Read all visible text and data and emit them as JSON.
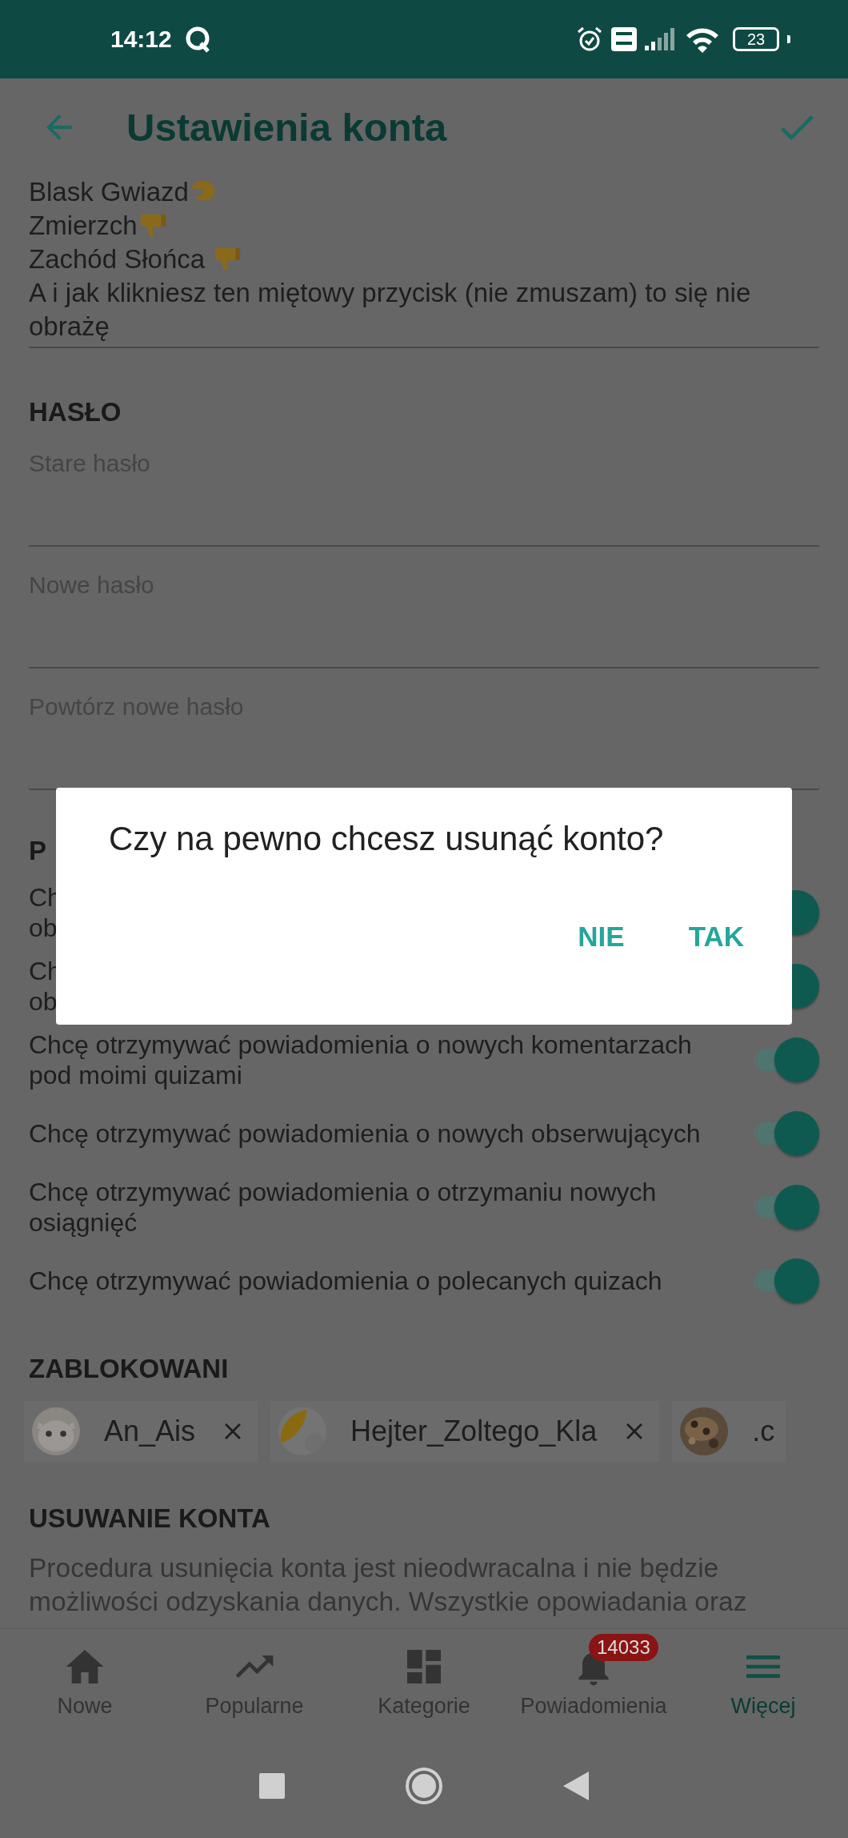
{
  "status_bar": {
    "time": "14:12",
    "battery": "23"
  },
  "app_bar": {
    "title": "Ustawienia konta"
  },
  "bio": {
    "lines": [
      {
        "text": "Blask Gwiazd",
        "kind": "ok-hand"
      },
      {
        "text": "Zmierzch",
        "kind": "thumbs-down"
      },
      {
        "text": "Zachód Słońca ",
        "kind": "thumbs-down"
      },
      {
        "text": "A i jak klikniesz ten miętowy przycisk (nie zmuszam) to się nie obrażę",
        "kind": "plain"
      }
    ]
  },
  "password": {
    "heading": "HASŁO",
    "fields": [
      {
        "placeholder": "Stare hasło"
      },
      {
        "placeholder": "Nowe hasło"
      },
      {
        "placeholder": "Powtórz nowe hasło"
      }
    ]
  },
  "notifications": {
    "heading": "P",
    "rows": [
      {
        "text": "Ch\nob",
        "checked": true
      },
      {
        "text": "Ch\nob",
        "checked": true
      },
      {
        "text": "Chcę otrzymywać powiadomienia o nowych komentarzach pod moimi quizami",
        "checked": true
      },
      {
        "text": "Chcę otrzymywać powiadomienia o nowych obserwujących",
        "checked": true
      },
      {
        "text": "Chcę otrzymywać powiadomienia o otrzymaniu nowych osiągnięć",
        "checked": true
      },
      {
        "text": "Chcę otrzymywać powiadomienia o polecanych quizach",
        "checked": true
      }
    ]
  },
  "blocked": {
    "heading": "ZABLOKOWANI",
    "users": [
      {
        "name": "An_Ais",
        "removable": true
      },
      {
        "name": "Hejter_Zoltego_Kla",
        "removable": true
      },
      {
        "name": ".c",
        "removable": false
      }
    ]
  },
  "delete_account": {
    "heading": "USUWANIE KONTA",
    "text": "Procedura usunięcia konta jest nieodwracalna i nie będzie możliwości odzyskania danych. Wszystkie opowiadania oraz"
  },
  "bottom_nav": [
    {
      "label": "Nowe",
      "kind": "home",
      "selected": false
    },
    {
      "label": "Popularne",
      "kind": "trending",
      "selected": false
    },
    {
      "label": "Kategorie",
      "kind": "dashboard",
      "selected": false
    },
    {
      "label": "Powiadomienia",
      "kind": "bell",
      "selected": false,
      "badge": "14033"
    },
    {
      "label": "Więcej",
      "kind": "menu",
      "selected": true
    }
  ],
  "dialog": {
    "message": "Czy na pewno chcesz usunąć konto?",
    "buttons": [
      "NIE",
      "TAK"
    ]
  }
}
